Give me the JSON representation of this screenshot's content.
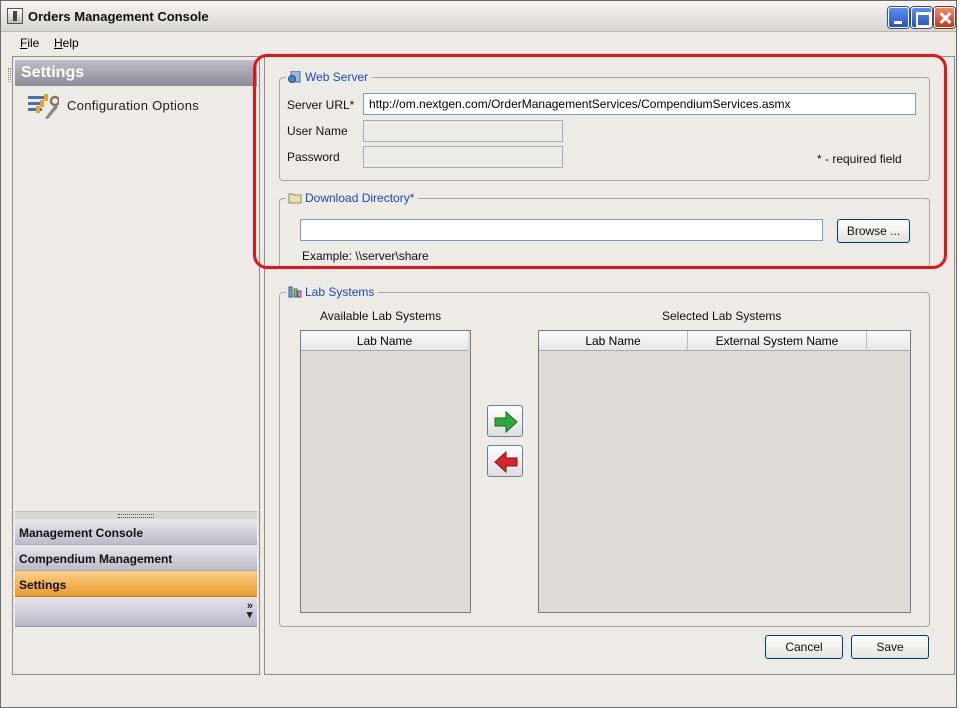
{
  "window": {
    "title": "Orders Management Console"
  },
  "menu": {
    "file": "File",
    "help": "Help"
  },
  "sidebar": {
    "header": "Settings",
    "config_item": "Configuration Options",
    "nav": [
      {
        "label": "Management Console"
      },
      {
        "label": "Compendium Management"
      },
      {
        "label": "Settings",
        "active": true
      }
    ],
    "overflow_glyph": "»",
    "dropdown_glyph": "▾"
  },
  "web_server": {
    "legend": "Web Server",
    "server_url_label": "Server URL*",
    "server_url_value": "http://om.nextgen.com/OrderManagementServices/CompendiumServices.asmx",
    "user_name_label": "User Name",
    "user_name_value": "",
    "password_label": "Password",
    "password_value": "",
    "required_note": "* - required field"
  },
  "download_directory": {
    "legend": "Download Directory*",
    "value": "",
    "browse_label": "Browse ...",
    "example": "Example:  \\\\server\\share"
  },
  "lab_systems": {
    "legend": "Lab Systems",
    "available_title": "Available Lab Systems",
    "available_columns": [
      "Lab Name"
    ],
    "selected_title": "Selected Lab Systems",
    "selected_columns": [
      "Lab Name",
      "External System Name"
    ]
  },
  "actions": {
    "cancel": "Cancel",
    "save": "Save"
  },
  "colors": {
    "accent_link": "#1b47c8",
    "active_nav": "#eb9c2c",
    "highlight_ring": "#e8141c",
    "arrow_add": "#2ea83a",
    "arrow_remove": "#d6262c"
  }
}
